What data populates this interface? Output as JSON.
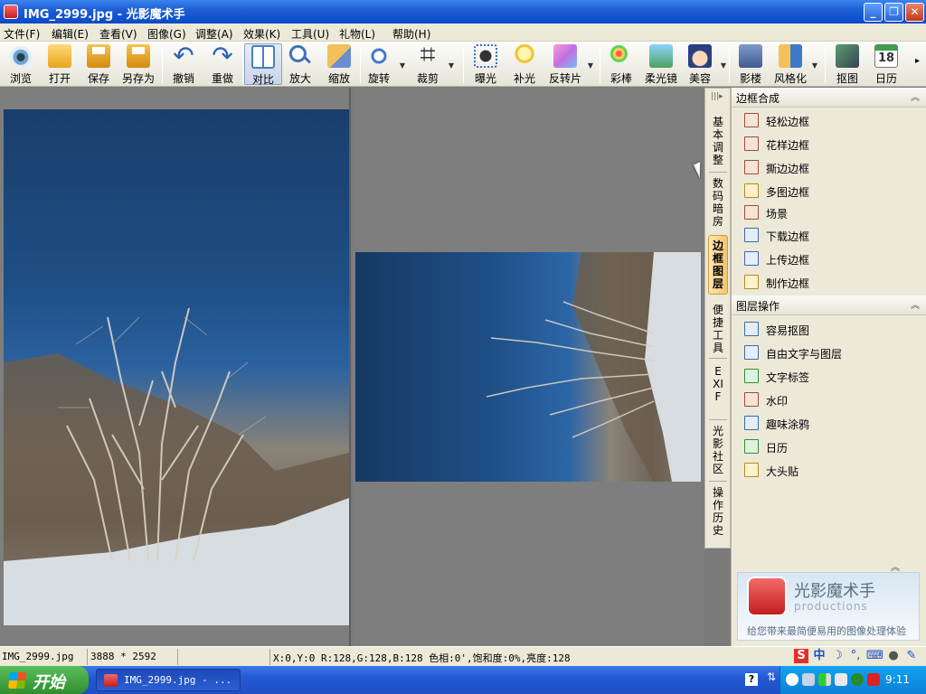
{
  "window": {
    "title": "IMG_2999.jpg - 光影魔术手",
    "buttons": {
      "minimize": "_",
      "maximize": "❐",
      "close": "✕"
    }
  },
  "menu": [
    "文件(F)",
    "编辑(E)",
    "查看(V)",
    "图像(G)",
    "调整(A)",
    "效果(K)",
    "工具(U)",
    "礼物(L)",
    "帮助(H)"
  ],
  "toolbar": {
    "browse": "浏览",
    "open": "打开",
    "save": "保存",
    "save_as": "另存为",
    "undo": "撤销",
    "redo": "重做",
    "compare": "对比",
    "zoom_in": "放大",
    "resize": "缩放",
    "rotate": "旋转",
    "crop": "裁剪",
    "exposure": "曝光",
    "fill_light": "补光",
    "reverse_film": "反转片",
    "color_wand": "彩棒",
    "soft_lens": "柔光镜",
    "beauty": "美容",
    "studio": "影楼",
    "stylize": "风格化",
    "cutout": "抠图",
    "calendar": "日历"
  },
  "vtabs": [
    "基本调整",
    "数码暗房",
    "边框图层",
    "便捷工具",
    "EXIF",
    "光影社区",
    "操作历史"
  ],
  "panel": {
    "frames_title": "边框合成",
    "frames": [
      "轻松边框",
      "花样边框",
      "撕边边框",
      "多图边框",
      "场景",
      "下载边框",
      "上传边框",
      "制作边框"
    ],
    "layers_title": "图层操作",
    "layers": [
      "容易抠图",
      "自由文字与图层",
      "文字标签",
      "水印",
      "趣味涂鸦",
      "日历",
      "大头贴"
    ],
    "promo_brand": "光影魔术手",
    "promo_sub": "productions",
    "promo_slogan": "给您带来最简便易用的图像处理体验"
  },
  "status": {
    "filename": "IMG_2999.jpg",
    "dimensions": "3888 * 2592",
    "pixel_info": "X:0,Y:0 R:128,G:128,B:128 色相:0',饱和度:0%,亮度:128"
  },
  "taskbar": {
    "start": "开始",
    "task": "IMG_2999.jpg - ...",
    "clock": "9:11"
  },
  "ime": {
    "s": "S",
    "zh": "中"
  }
}
